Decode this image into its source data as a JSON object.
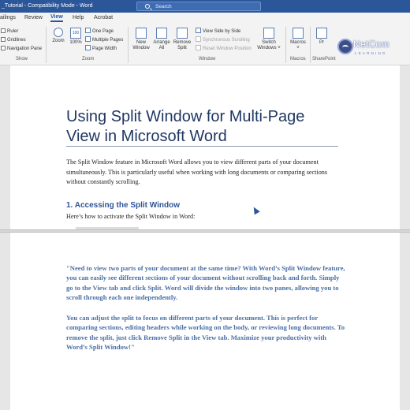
{
  "window": {
    "title": "_Tutorial  -  Compatibility Mode  -  Word",
    "search_placeholder": "Search"
  },
  "tabs": [
    {
      "label": "ailings"
    },
    {
      "label": "Review"
    },
    {
      "label": "View",
      "active": true
    },
    {
      "label": "Help"
    },
    {
      "label": "Acrobat"
    }
  ],
  "ribbon": {
    "show": {
      "items": [
        "Ruler",
        "Gridlines",
        "Navigation Pane"
      ],
      "group_label": "Show"
    },
    "zoom": {
      "zoom_label": "Zoom",
      "percent_label": "100%",
      "one_page": "One Page",
      "multiple_pages": "Multiple Pages",
      "page_width": "Page Width",
      "group_label": "Zoom"
    },
    "window": {
      "new_window": [
        "New",
        "Window"
      ],
      "arrange_all": [
        "Arrange",
        "All"
      ],
      "remove_split": [
        "Remove",
        "Split"
      ],
      "view_side_by_side": "View Side by Side",
      "sync_scrolling": "Synchronous Scrolling",
      "reset_window_position": "Reset Window Position",
      "switch_windows": [
        "Switch",
        "Windows ˅"
      ],
      "group_label": "Window"
    },
    "macros": {
      "label": [
        "Macros",
        "˅"
      ],
      "group_label": "Macros"
    },
    "sharepoint": {
      "label": "Pr",
      "group_label": "SharePoint"
    }
  },
  "watermark": {
    "brand": "NetCom",
    "tagline": "LEARNING"
  },
  "document": {
    "title": "Using Split Window for Multi-Page View in Microsoft Word",
    "intro": "The Split Window feature in Microsoft Word allows you to view different parts of your document simultaneously. This is particularly useful when working with long documents or comparing sections without constantly scrolling.",
    "section_heading": "1. Accessing the Split Window",
    "section_lead": "Here’s how to activate the Split Window in Word:",
    "quote_1": "\"Need to view two parts of your document at the same time? With Word’s Split Window feature, you can easily see different sections of your document without scrolling back and forth. Simply go to the View tab and click Split. Word will divide the window into two panes, allowing you to scroll through each one independently.",
    "quote_2": "You can adjust the split to focus on different parts of your document. This is perfect for comparing sections, editing headers while working on the body, or reviewing long documents. To remove the split, just click Remove Split in the View tab. Maximize your productivity with Word’s Split Window!\""
  }
}
